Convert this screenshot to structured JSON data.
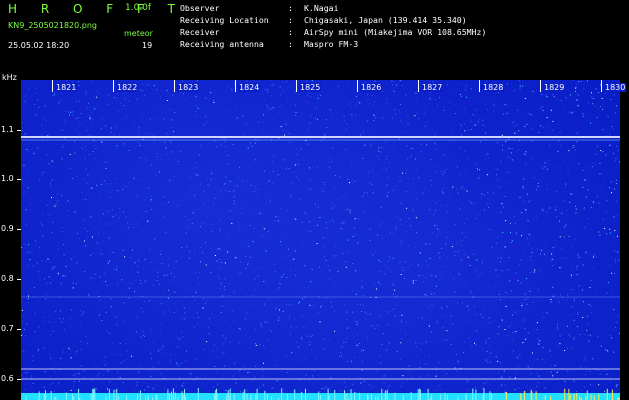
{
  "header": {
    "app_title": "H R O F F T",
    "version": "1.0.0f",
    "filename": "KN9_2505021820.png",
    "mode": "meteor",
    "datetime": "25.05.02 18:20",
    "count": "19"
  },
  "info": [
    {
      "label": "Observer",
      "sep": ":",
      "value": "K.Nagai"
    },
    {
      "label": "Receiving Location",
      "sep": ":",
      "value": "Chigasaki, Japan (139.414 35.340)"
    },
    {
      "label": "Receiver",
      "sep": ":",
      "value": "AirSpy mini (Miakejima VOR 108.65MHz)"
    },
    {
      "label": "Receiving antenna",
      "sep": ":",
      "value": "Maspro FM-3"
    }
  ],
  "axis": {
    "y_unit": "kHz",
    "y_ticks": [
      "1.1",
      "1.0",
      "0.9",
      "0.8",
      "0.7",
      "0.6"
    ],
    "x_ticks": [
      "1821",
      "1822",
      "1823",
      "1824",
      "1825",
      "1826",
      "1827",
      "1828",
      "1829",
      "1830"
    ]
  },
  "colors": {
    "header_green": "#7CFF3A",
    "spectrogram_bg": "#0a1ec8",
    "carrier_line": "#e8e8ff",
    "noise_floor": "#22e0ff"
  }
}
